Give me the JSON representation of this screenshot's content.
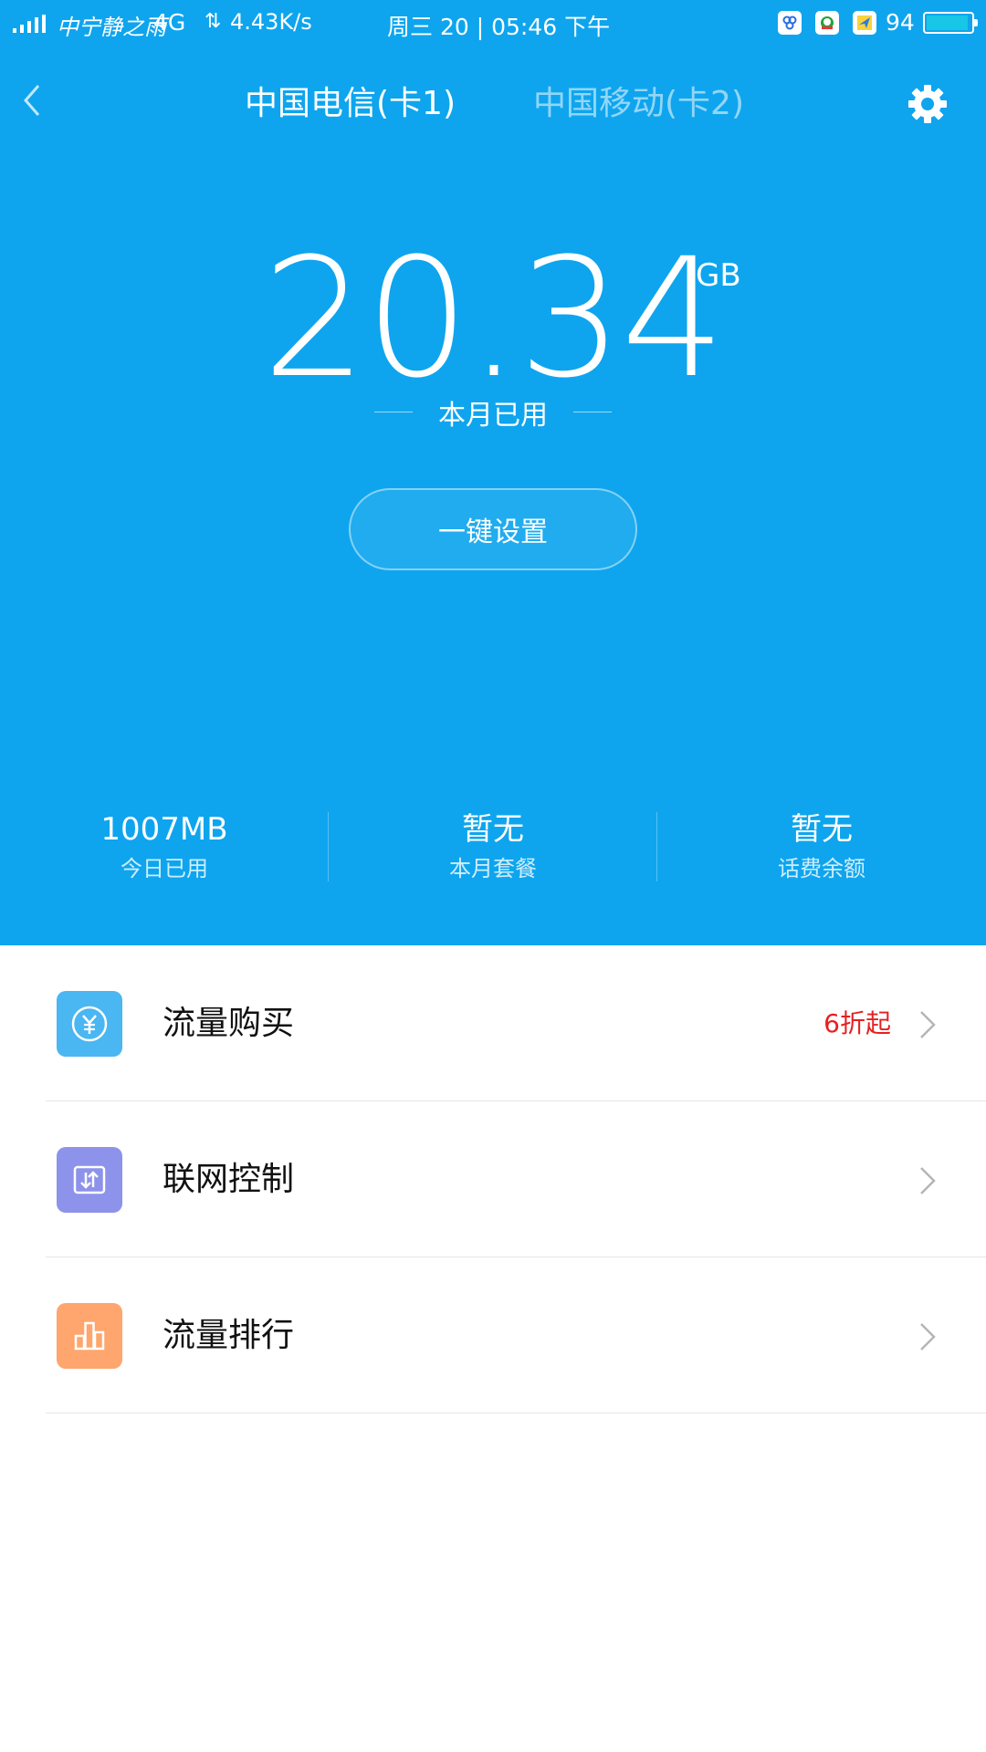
{
  "status_bar": {
    "carrier": "中宁静之雨",
    "network": "4G",
    "speed": "4.43K/s",
    "datetime": "周三 20 | 05:46 下午",
    "battery": "94",
    "battery_level": 0.94
  },
  "header": {
    "tab1": "中国电信(卡1)",
    "tab2": "中国移动(卡2)"
  },
  "usage": {
    "value": "20.34",
    "unit": "GB",
    "label": "本月已用"
  },
  "onekey_button": "一键设置",
  "stats": [
    {
      "value": "1007MB",
      "label": "今日已用"
    },
    {
      "value": "暂无",
      "label": "本月套餐"
    },
    {
      "value": "暂无",
      "label": "话费余额"
    }
  ],
  "menu": [
    {
      "title": "流量购买",
      "promo": "6折起",
      "icon": "yuan-icon",
      "color": "#4ab6f2"
    },
    {
      "title": "联网控制",
      "promo": "",
      "icon": "network-control-icon",
      "color": "#8d92ea"
    },
    {
      "title": "流量排行",
      "promo": "",
      "icon": "bar-chart-icon",
      "color": "#fea66d"
    }
  ]
}
